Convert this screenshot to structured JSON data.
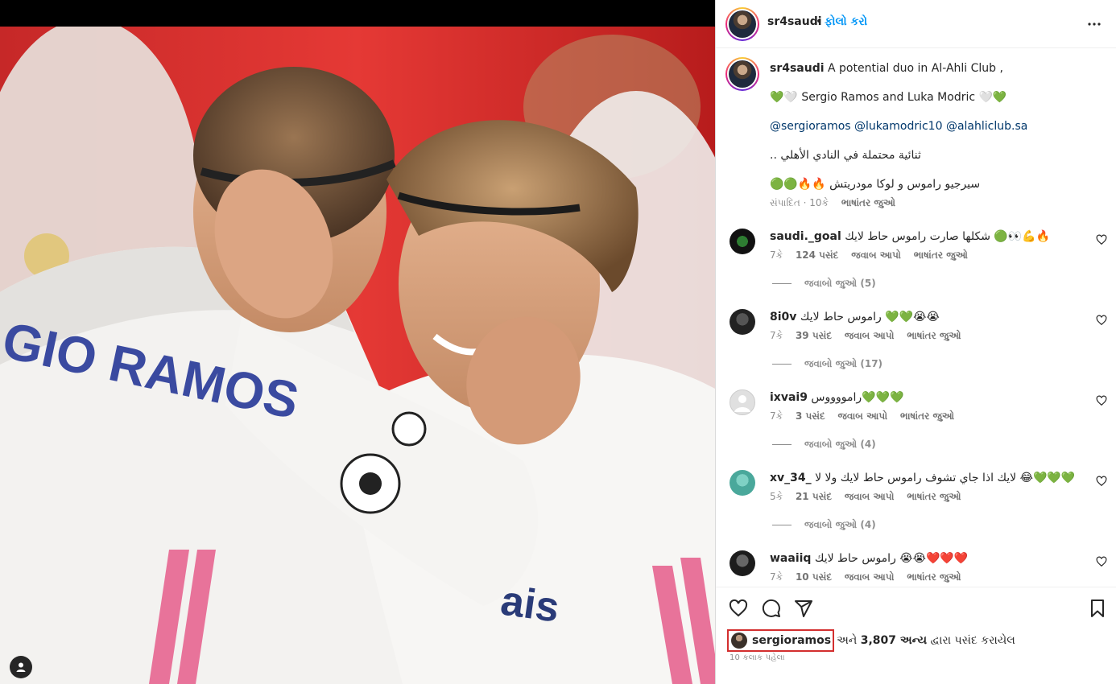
{
  "post": {
    "username": "sr4saudi",
    "separator": "•",
    "follow_label": "ફોલો કરો"
  },
  "caption": {
    "username": "sr4saudi",
    "line1": "A potential duo in Al-Ahli Club ,",
    "line2": "💚🤍 Sergio Ramos and Luka Modric 🤍💚",
    "mentions": [
      "@sergioramos",
      "@lukamodric10",
      "@alahliclub.sa"
    ],
    "line4": "ثنائية محتملة في النادي الأهلي ..",
    "line5": "سيرجيو راموس و لوكا مودريتش 🔥🔥🟢🟢",
    "meta_edited": "સંપાદિત · 10કે",
    "meta_translate": "ભાષાંતર જુઓ"
  },
  "comments": [
    {
      "username": "saudi._goal",
      "text": "شكلها صارت راموس حاط لايك 🟢👀💪🔥",
      "time": "7કે",
      "likes": "124 પસંદ",
      "reply": "જવાબ આપો",
      "translate": "ભાષાંતર જુઓ",
      "view_replies": "જવાબો જુઓ (5)"
    },
    {
      "username": "8i0v",
      "text": "راموس حاط لايك 💚💚😭😭",
      "time": "7કે",
      "likes": "39 પસંદ",
      "reply": "જવાબ આપો",
      "translate": "ભાષાંતર જુઓ",
      "view_replies": "જવાબો જુઓ (17)"
    },
    {
      "username": "ixvai9",
      "text": "رامووووس💚💚💚",
      "time": "7કે",
      "likes": "3 પસંદ",
      "reply": "જવાબ આપો",
      "translate": "ભાષાંતર જુઓ",
      "view_replies": "જવાબો જુઓ (4)"
    },
    {
      "username": "xv_34_",
      "text": "لايك اذا جاي تشوف راموس حاط لايك ولا لا 😂💚💚💚",
      "time": "5કે",
      "likes": "21 પસંદ",
      "reply": "જવાબ આપો",
      "translate": "ભાષાંતર જુઓ",
      "view_replies": "જવાબો જુઓ (4)"
    },
    {
      "username": "waaiiq",
      "text": "راموس حاط لايك 😭😭❤️❤️❤️",
      "time": "7કે",
      "likes": "10 પસંદ",
      "reply": "જવાબ આપો",
      "translate": "ભાષાંતર જુઓ"
    }
  ],
  "likes": {
    "liker": "sergioramos",
    "rest_prefix": "અને",
    "count_text": "3,807 અન્ય",
    "rest_suffix": "દ્વારા પસંદ કરાયેલ"
  },
  "post_time": "10 કલાક પહેલા",
  "photo": {
    "jersey_text": "GIO RAMOS"
  },
  "icons": {
    "more": "more-horizontal-icon",
    "like": "heart-icon",
    "comment": "comment-icon",
    "share": "share-icon",
    "save": "bookmark-icon",
    "tag": "user-tag-icon"
  },
  "colors": {
    "accent": "#0095f6",
    "highlight_box": "#d32f2f"
  }
}
